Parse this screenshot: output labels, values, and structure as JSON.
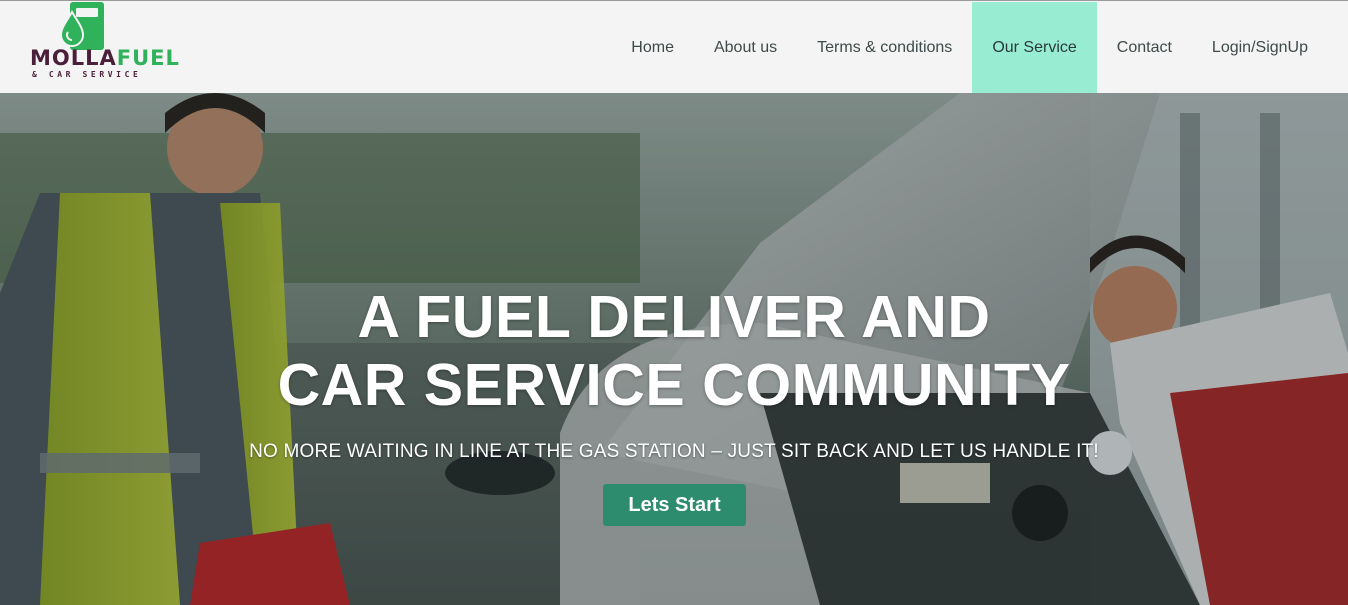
{
  "brand": {
    "word1": "MOLLA",
    "word2": "FUEL",
    "tagline": "& CAR SERVICE",
    "colors": {
      "dark": "#4a1f3a",
      "green": "#2fb25a"
    }
  },
  "nav": {
    "items": [
      {
        "label": "Home",
        "active": false
      },
      {
        "label": "About us",
        "active": false
      },
      {
        "label": "Terms & conditions",
        "active": false
      },
      {
        "label": "Our Service",
        "active": true
      },
      {
        "label": "Contact",
        "active": false
      },
      {
        "label": "Login/SignUp",
        "active": false
      }
    ],
    "active_color": "#98ecd2"
  },
  "hero": {
    "title_line1": "A FUEL DELIVER AND",
    "title_line2": "CAR SERVICE COMMUNITY",
    "subtitle": "NO MORE WAITING IN LINE AT THE GAS STATION – JUST SIT BACK AND LET US HANDLE IT!",
    "cta_label": "Lets Start",
    "cta_color": "#2e8c6e"
  }
}
